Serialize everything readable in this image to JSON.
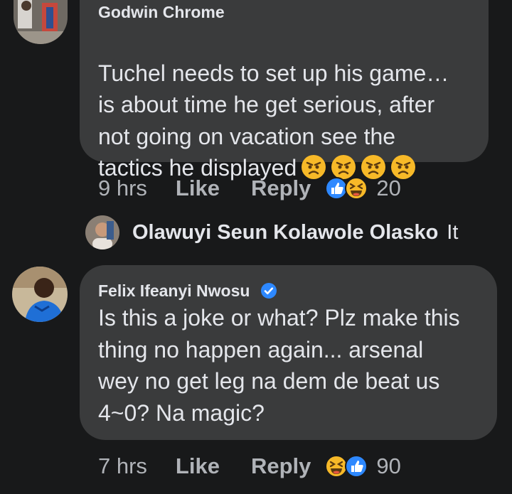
{
  "comments": [
    {
      "author": "Godwin Chrome",
      "text": "Tuchel needs to set up his game…\nis about time he get serious, after\nnot going on vacation see the\ntactics he displayed",
      "emoji_icons": [
        "angry-face-icon",
        "angry-face-icon",
        "angry-face-icon",
        "angry-face-icon"
      ],
      "time": "9 hrs",
      "like_label": "Like",
      "reply_label": "Reply",
      "reaction_icons": [
        "like-reaction-icon",
        "haha-reaction-icon"
      ],
      "reaction_count": "20"
    },
    {
      "author": "Felix Ifeanyi Nwosu",
      "verified": true,
      "text": "Is this a joke or what? Plz make this\nthing no happen again... arsenal\nwey no get leg na dem de beat us\n4~0? Na magic?",
      "time": "7 hrs",
      "like_label": "Like",
      "reply_label": "Reply",
      "reaction_icons": [
        "haha-reaction-icon",
        "like-reaction-icon"
      ],
      "reaction_count": "90"
    }
  ],
  "collapsed_reply": {
    "author": "Olawuyi Seun Kolawole Olasko",
    "preview": "It"
  },
  "colors": {
    "background": "#18191a",
    "bubble": "#3a3b3c",
    "text": "#e4e6eb",
    "secondary_text": "#b0b3b8",
    "like_blue": "#2d88ff",
    "emoji_yellow": "#f7b928"
  }
}
